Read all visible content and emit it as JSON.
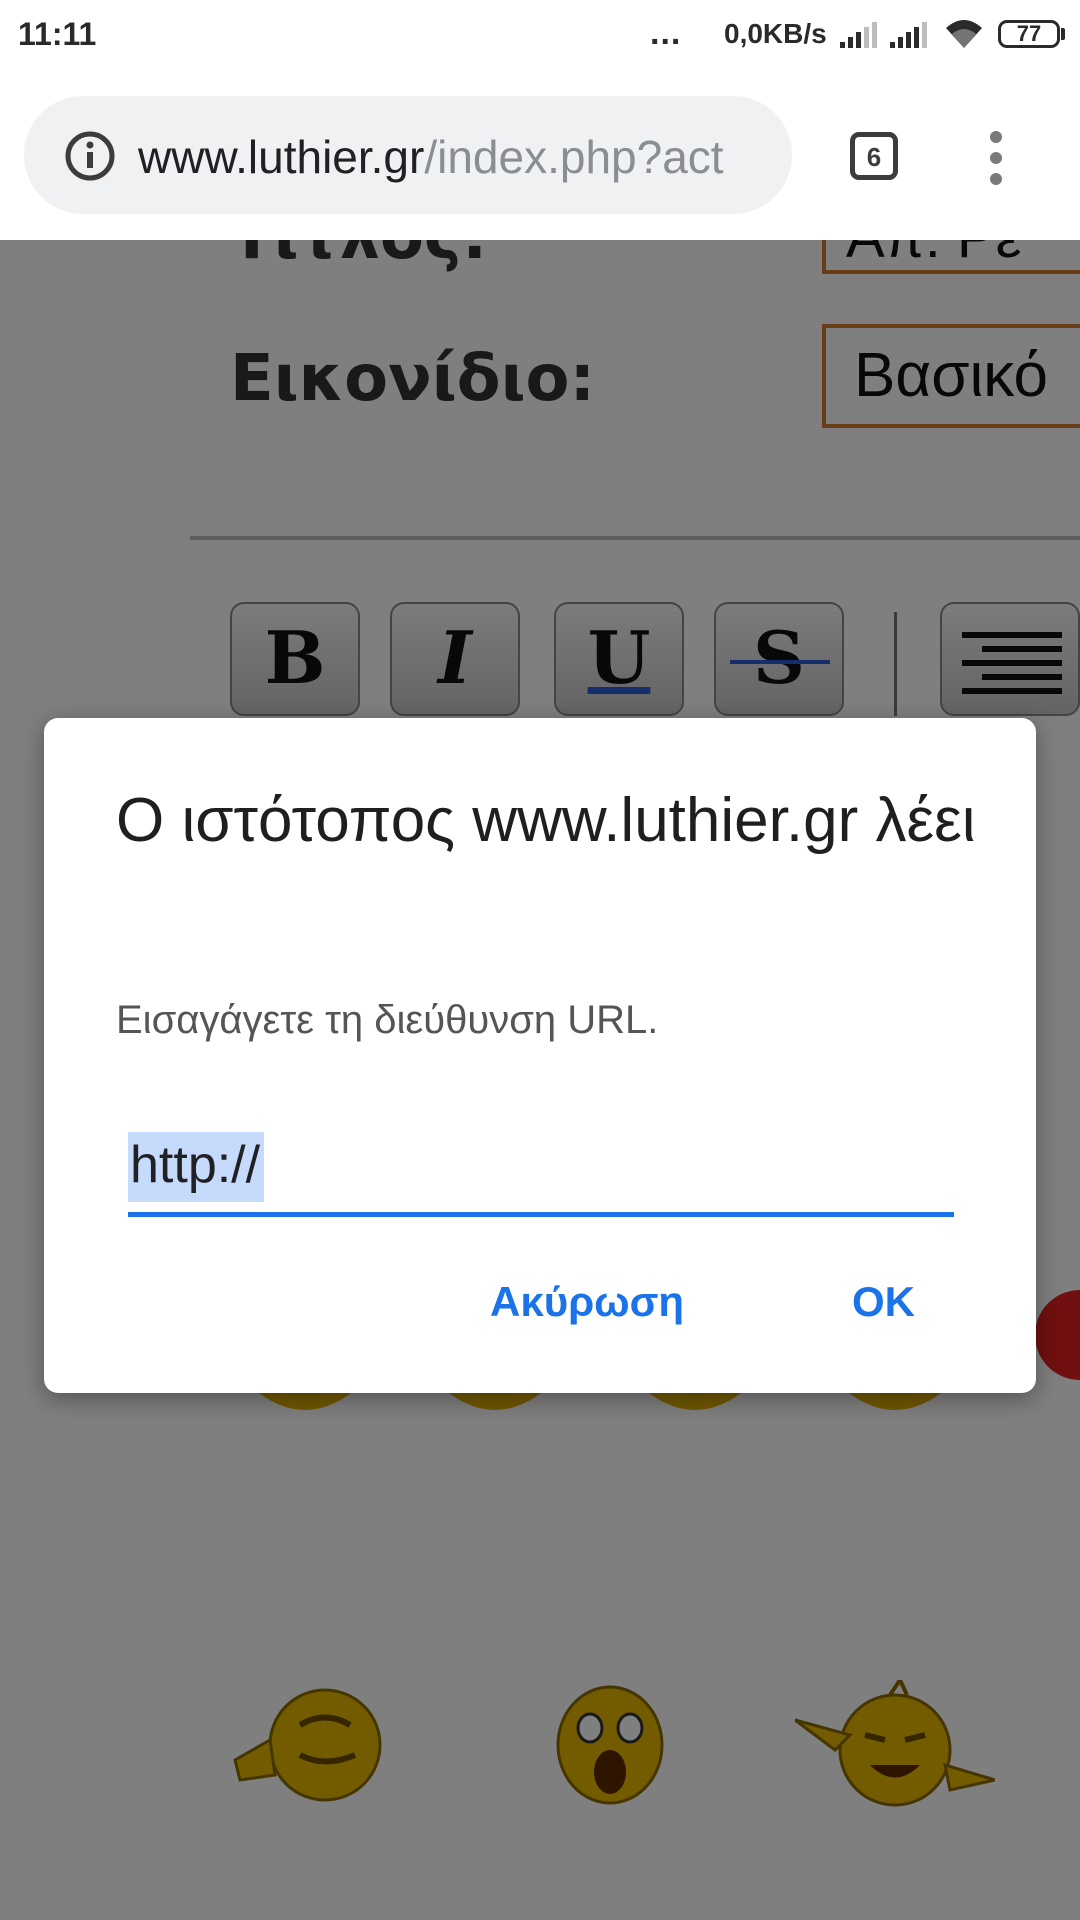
{
  "status_bar": {
    "time": "11:11",
    "dots": "...",
    "speed": "0,0KB/s",
    "battery": "77"
  },
  "browser": {
    "url_domain": "www.luthier.gr",
    "url_path": "/index.php?act",
    "tab_count": "6"
  },
  "page": {
    "title_label": "Τίτλος:",
    "title_value": "Απ: Ρε",
    "icon_label": "Εικονίδιο:",
    "icon_value": "Βασικό",
    "toolbar": {
      "bold": "B",
      "italic": "I",
      "underline": "U",
      "strike": "S"
    }
  },
  "dialog": {
    "title": "Ο ιστότοπος www.luthier.gr λέει",
    "message": "Εισαγάγετε τη διεύθυνση URL.",
    "input_value": "http://",
    "cancel": "Ακύρωση",
    "ok": "OK"
  },
  "colors": {
    "accent": "#1a73e8",
    "selection": "#c6dafc",
    "field_border": "#d27a2e",
    "overlay": "rgba(0,0,0,0.5)"
  }
}
